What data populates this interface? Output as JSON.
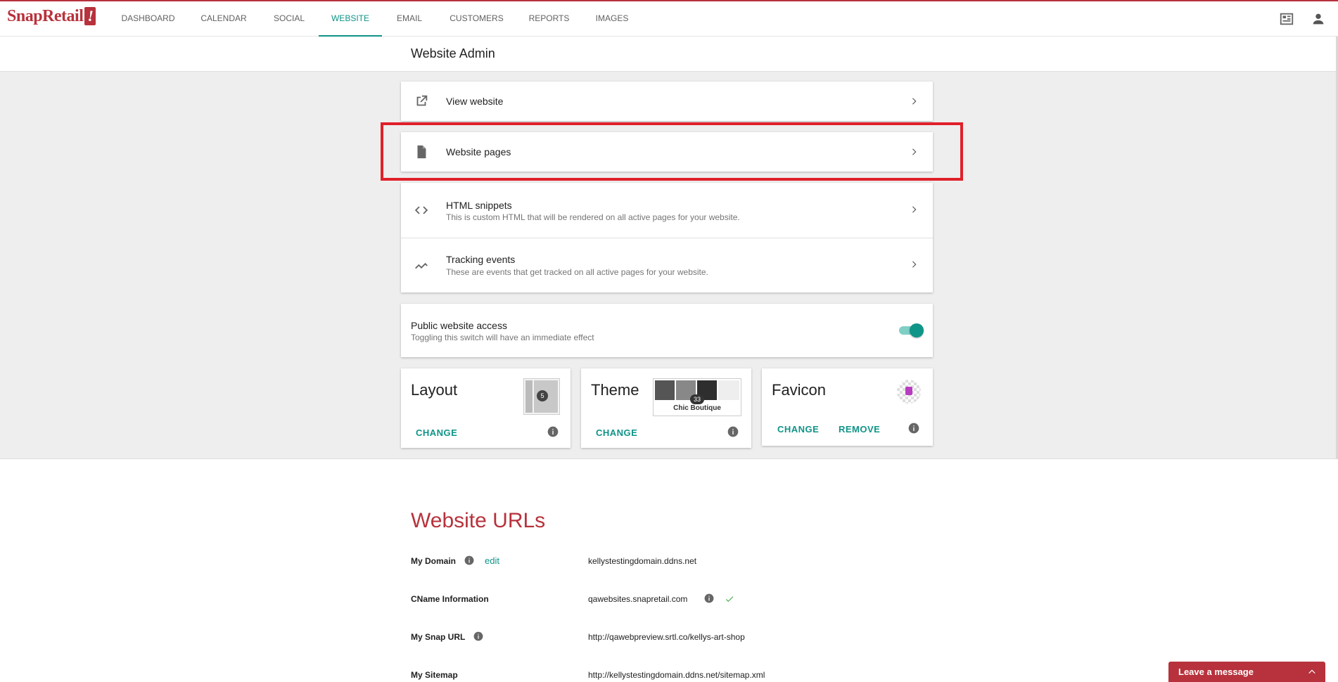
{
  "brand": {
    "name": "SnapRetail",
    "mark": "!"
  },
  "nav": {
    "tabs": [
      {
        "label": "DASHBOARD"
      },
      {
        "label": "CALENDAR"
      },
      {
        "label": "SOCIAL"
      },
      {
        "label": "WEBSITE",
        "active": true
      },
      {
        "label": "EMAIL"
      },
      {
        "label": "CUSTOMERS"
      },
      {
        "label": "REPORTS"
      },
      {
        "label": "IMAGES"
      }
    ],
    "right_icons": [
      "store-icon",
      "account-icon"
    ]
  },
  "page": {
    "title": "Website Admin"
  },
  "admin_rows": [
    {
      "title": "View website",
      "subtitle": "",
      "icon": "open-in-new-icon"
    },
    {
      "title": "Website pages",
      "subtitle": "",
      "icon": "file-icon"
    },
    {
      "title": "HTML snippets",
      "subtitle": "This is custom HTML that will be rendered on all active pages for your website.",
      "icon": "code-icon"
    },
    {
      "title": "Tracking events",
      "subtitle": "These are events that get tracked on all active pages for your website.",
      "icon": "trending-icon"
    }
  ],
  "public_access": {
    "title": "Public website access",
    "subtitle": "Toggling this switch will have an immediate effect",
    "enabled": true
  },
  "tiles": {
    "layout": {
      "title": "Layout",
      "change_label": "CHANGE",
      "thumb_number": "5"
    },
    "theme": {
      "title": "Theme",
      "change_label": "CHANGE",
      "thumb_number": "33",
      "theme_name": "Chic Boutique"
    },
    "favicon": {
      "title": "Favicon",
      "change_label": "CHANGE",
      "remove_label": "REMOVE"
    }
  },
  "urls": {
    "title": "Website URLs",
    "edit_label": "edit",
    "rows": [
      {
        "label": "My Domain",
        "value": "kellystestingdomain.ddns.net"
      },
      {
        "label": "CName Information",
        "value": "qawebsites.snapretail.com"
      },
      {
        "label": "My Snap URL",
        "value": "http://qawebpreview.srtl.co/kellys-art-shop"
      },
      {
        "label": "My Sitemap",
        "value": "http://kellystestingdomain.ddns.net/sitemap.xml"
      }
    ]
  },
  "chat": {
    "label": "Leave a message"
  },
  "colors": {
    "brand": "#b7323c",
    "accent": "#0f9488",
    "highlight": "#e0202a"
  }
}
